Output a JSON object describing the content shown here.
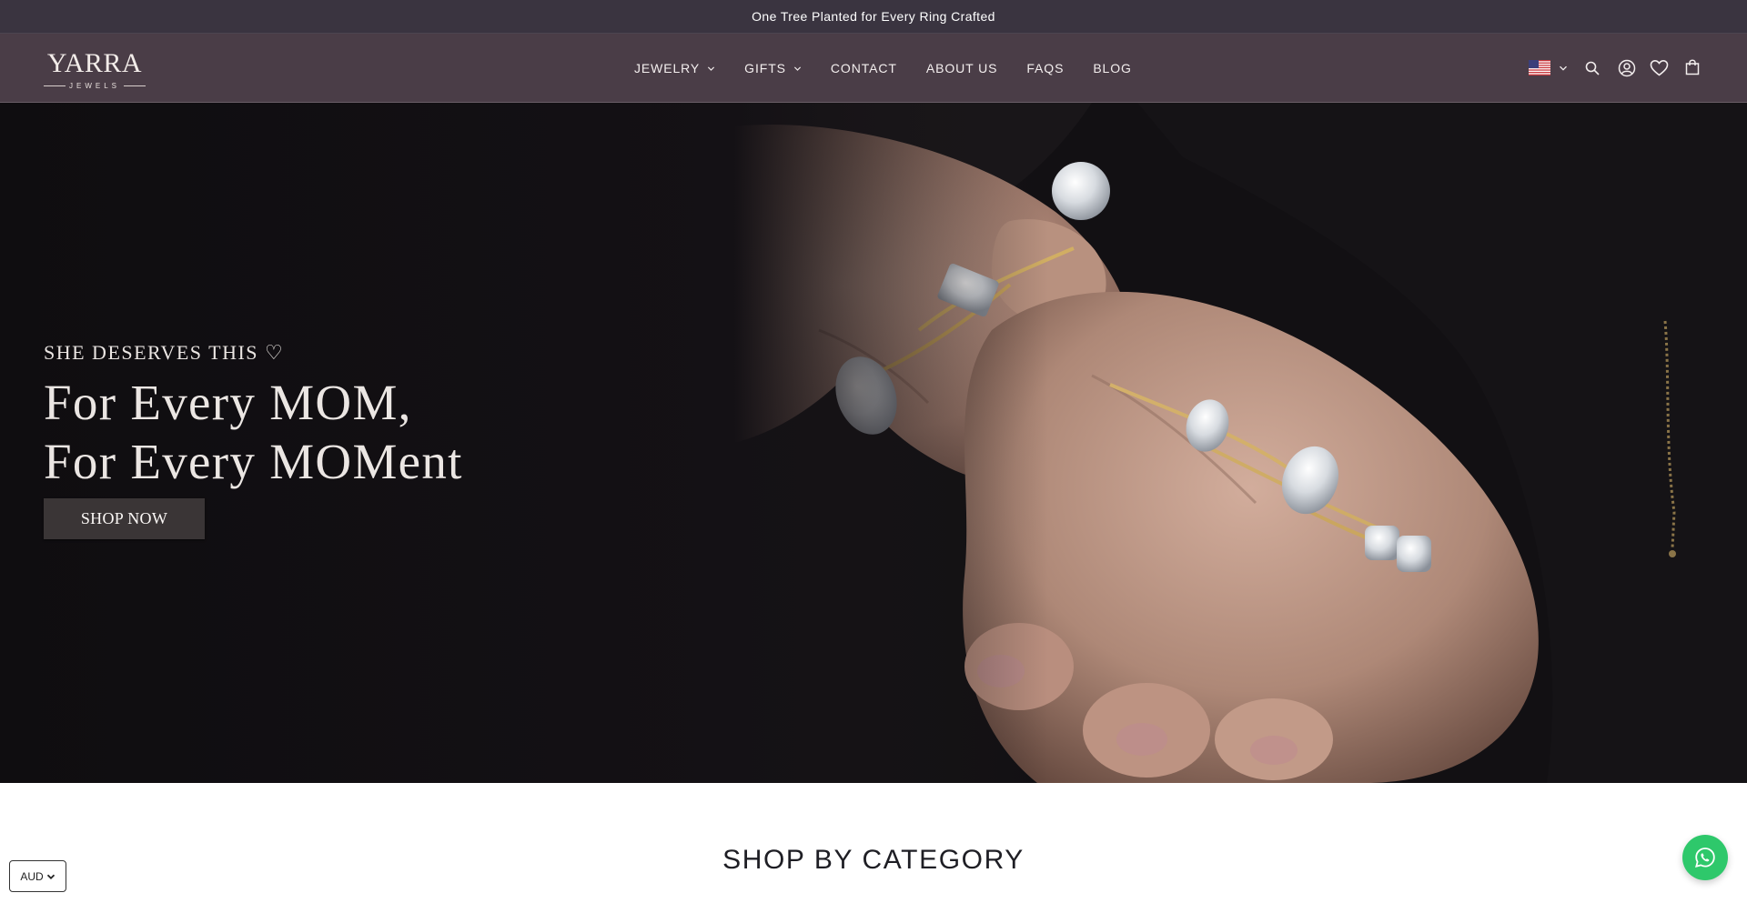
{
  "announcement": {
    "text": "One Tree Planted for Every Ring Crafted"
  },
  "header": {
    "logo": {
      "main": "YARRA",
      "sub": "JEWELS"
    },
    "nav": [
      {
        "label": "JEWELRY",
        "has_dropdown": true
      },
      {
        "label": "GIFTS",
        "has_dropdown": true
      },
      {
        "label": "CONTACT",
        "has_dropdown": false
      },
      {
        "label": "ABOUT US",
        "has_dropdown": false
      },
      {
        "label": "FAQS",
        "has_dropdown": false
      },
      {
        "label": "BLOG",
        "has_dropdown": false
      }
    ],
    "icons": [
      "us-flag-icon",
      "chevron-down-icon",
      "search-icon",
      "account-icon",
      "heart-icon",
      "bag-icon"
    ]
  },
  "hero": {
    "eyebrow": "SHE DESERVES THIS ♡",
    "headline_line1": "For Every MOM,",
    "headline_line2": "For Every MOMent",
    "cta": "SHOP NOW"
  },
  "section": {
    "title": "SHOP BY CATEGORY"
  },
  "currency": {
    "selected": "AUD"
  },
  "colors": {
    "announcement_bg": "#3a3440",
    "header_bg": "#4a3d47",
    "hero_bg": "#0f0d10",
    "button_bg": "#3a3536",
    "whatsapp": "#2ec86b"
  }
}
